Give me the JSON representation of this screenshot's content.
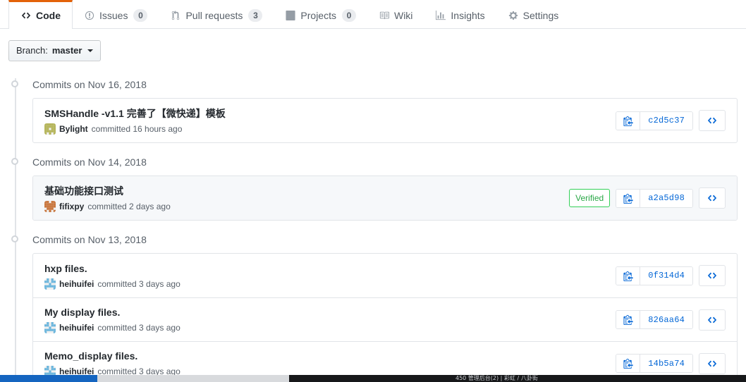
{
  "repo_nav": {
    "tabs": [
      {
        "label": "Code",
        "icon": "code-icon",
        "count": null,
        "selected": true
      },
      {
        "label": "Issues",
        "icon": "issue-opened-icon",
        "count": "0",
        "selected": false
      },
      {
        "label": "Pull requests",
        "icon": "git-pull-request-icon",
        "count": "3",
        "selected": false
      },
      {
        "label": "Projects",
        "icon": "project-icon",
        "count": "0",
        "selected": false
      },
      {
        "label": "Wiki",
        "icon": "book-icon",
        "count": null,
        "selected": false
      },
      {
        "label": "Insights",
        "icon": "graph-icon",
        "count": null,
        "selected": false
      },
      {
        "label": "Settings",
        "icon": "gear-icon",
        "count": null,
        "selected": false
      }
    ],
    "accent_color": "#e36209"
  },
  "branch_selector": {
    "prefix": "Branch:",
    "branch": "master",
    "icon": "chevron-down-icon"
  },
  "commit_groups": [
    {
      "date_label": "Commits on Nov 16, 2018",
      "commits": [
        {
          "title": "SMSHandle -v1.1 完善了【微快递】模板",
          "author": "Bylight",
          "meta_suffix": "committed 16 hours ago",
          "sha": "c2d5c37",
          "verified": null,
          "avatar_color": "#b5b55a",
          "highlighted": false
        }
      ]
    },
    {
      "date_label": "Commits on Nov 14, 2018",
      "commits": [
        {
          "title": "基础功能接口测试",
          "author": "fifixpy",
          "meta_suffix": "committed 2 days ago",
          "sha": "a2a5d98",
          "verified": "Verified",
          "avatar_color": "#c9773f",
          "highlighted": true
        }
      ]
    },
    {
      "date_label": "Commits on Nov 13, 2018",
      "commits": [
        {
          "title": "hxp files.",
          "author": "heihuifei",
          "meta_suffix": "committed 3 days ago",
          "sha": "0f314d4",
          "verified": null,
          "avatar_color": "#6cb6dd",
          "highlighted": false
        },
        {
          "title": "My display files.",
          "author": "heihuifei",
          "meta_suffix": "committed 3 days ago",
          "sha": "826aa64",
          "verified": null,
          "avatar_color": "#6cb6dd",
          "highlighted": false
        },
        {
          "title": "Memo_display files.",
          "author": "heihuifei",
          "meta_suffix": "committed 3 days ago",
          "sha": "14b5a74",
          "verified": null,
          "avatar_color": "#6cb6dd",
          "highlighted": false
        }
      ]
    }
  ],
  "commit_actions": {
    "copy_icon": "clipboard-copy-icon",
    "browse_icon": "code-brackets-icon",
    "verified_color": "#28a745",
    "link_color": "#0366d6"
  },
  "taskbar": {
    "text": "450   管理后台(2) | 彩虹 / 八卦街"
  }
}
